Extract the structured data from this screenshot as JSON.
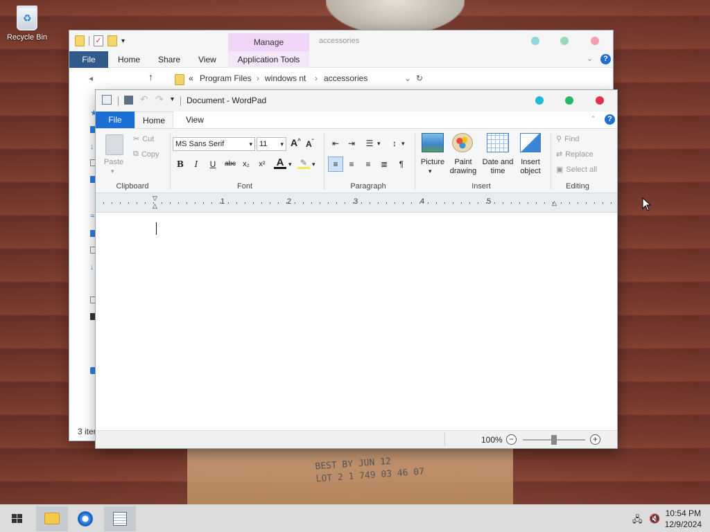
{
  "desktop": {
    "recycle_bin_label": "Recycle Bin",
    "background_stamp_line1": "BEST BY  JUN 12",
    "background_stamp_line2": "LOT 2 1 749 03 46 07"
  },
  "explorer": {
    "contextual_tab": "Manage",
    "title_path": "accessories",
    "tabs": [
      "File",
      "Home",
      "Share",
      "View",
      "Application Tools"
    ],
    "breadcrumb": [
      "Program Files",
      "windows nt",
      "accessories"
    ],
    "status_text": "3 iter"
  },
  "wordpad": {
    "title": "Document - WordPad",
    "tabs": {
      "file": "File",
      "home": "Home",
      "view": "View"
    },
    "clipboard": {
      "paste": "Paste",
      "cut": "Cut",
      "copy": "Copy",
      "group": "Clipboard"
    },
    "font": {
      "family": "MS Sans Serif",
      "size": "11",
      "group": "Font"
    },
    "paragraph": {
      "group": "Paragraph"
    },
    "insert": {
      "picture": "Picture",
      "paint_line1": "Paint",
      "paint_line2": "drawing",
      "datetime_line1": "Date and",
      "datetime_line2": "time",
      "object_line1": "Insert",
      "object_line2": "object",
      "group": "Insert"
    },
    "editing": {
      "find": "Find",
      "replace": "Replace",
      "select_all": "Select all",
      "group": "Editing"
    },
    "ruler_numbers": [
      "1",
      "2",
      "3",
      "4",
      "5"
    ],
    "zoom": "100%"
  },
  "taskbar": {
    "time": "10:54 PM",
    "date": "12/9/2024"
  },
  "colors": {
    "accent_blue": "#1a6fd4",
    "win_cyan": "#1fb8d8",
    "win_green": "#26b56a",
    "win_red": "#e0304a"
  }
}
